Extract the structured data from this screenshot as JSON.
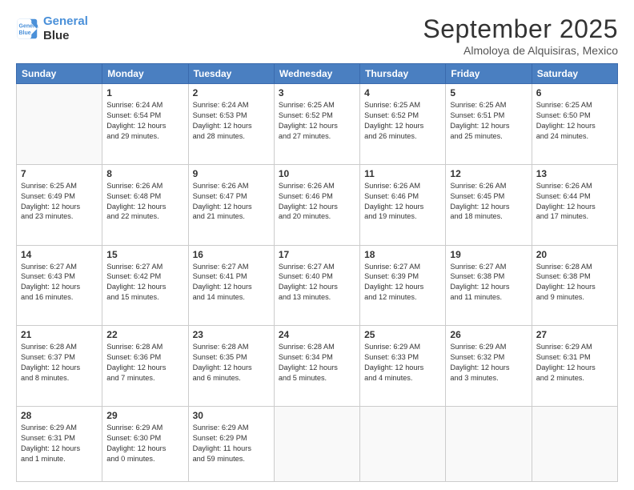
{
  "logo": {
    "line1": "General",
    "line2": "Blue"
  },
  "title": "September 2025",
  "subtitle": "Almoloya de Alquisiras, Mexico",
  "days_header": [
    "Sunday",
    "Monday",
    "Tuesday",
    "Wednesday",
    "Thursday",
    "Friday",
    "Saturday"
  ],
  "weeks": [
    [
      {
        "num": "",
        "info": ""
      },
      {
        "num": "1",
        "info": "Sunrise: 6:24 AM\nSunset: 6:54 PM\nDaylight: 12 hours\nand 29 minutes."
      },
      {
        "num": "2",
        "info": "Sunrise: 6:24 AM\nSunset: 6:53 PM\nDaylight: 12 hours\nand 28 minutes."
      },
      {
        "num": "3",
        "info": "Sunrise: 6:25 AM\nSunset: 6:52 PM\nDaylight: 12 hours\nand 27 minutes."
      },
      {
        "num": "4",
        "info": "Sunrise: 6:25 AM\nSunset: 6:52 PM\nDaylight: 12 hours\nand 26 minutes."
      },
      {
        "num": "5",
        "info": "Sunrise: 6:25 AM\nSunset: 6:51 PM\nDaylight: 12 hours\nand 25 minutes."
      },
      {
        "num": "6",
        "info": "Sunrise: 6:25 AM\nSunset: 6:50 PM\nDaylight: 12 hours\nand 24 minutes."
      }
    ],
    [
      {
        "num": "7",
        "info": "Sunrise: 6:25 AM\nSunset: 6:49 PM\nDaylight: 12 hours\nand 23 minutes."
      },
      {
        "num": "8",
        "info": "Sunrise: 6:26 AM\nSunset: 6:48 PM\nDaylight: 12 hours\nand 22 minutes."
      },
      {
        "num": "9",
        "info": "Sunrise: 6:26 AM\nSunset: 6:47 PM\nDaylight: 12 hours\nand 21 minutes."
      },
      {
        "num": "10",
        "info": "Sunrise: 6:26 AM\nSunset: 6:46 PM\nDaylight: 12 hours\nand 20 minutes."
      },
      {
        "num": "11",
        "info": "Sunrise: 6:26 AM\nSunset: 6:46 PM\nDaylight: 12 hours\nand 19 minutes."
      },
      {
        "num": "12",
        "info": "Sunrise: 6:26 AM\nSunset: 6:45 PM\nDaylight: 12 hours\nand 18 minutes."
      },
      {
        "num": "13",
        "info": "Sunrise: 6:26 AM\nSunset: 6:44 PM\nDaylight: 12 hours\nand 17 minutes."
      }
    ],
    [
      {
        "num": "14",
        "info": "Sunrise: 6:27 AM\nSunset: 6:43 PM\nDaylight: 12 hours\nand 16 minutes."
      },
      {
        "num": "15",
        "info": "Sunrise: 6:27 AM\nSunset: 6:42 PM\nDaylight: 12 hours\nand 15 minutes."
      },
      {
        "num": "16",
        "info": "Sunrise: 6:27 AM\nSunset: 6:41 PM\nDaylight: 12 hours\nand 14 minutes."
      },
      {
        "num": "17",
        "info": "Sunrise: 6:27 AM\nSunset: 6:40 PM\nDaylight: 12 hours\nand 13 minutes."
      },
      {
        "num": "18",
        "info": "Sunrise: 6:27 AM\nSunset: 6:39 PM\nDaylight: 12 hours\nand 12 minutes."
      },
      {
        "num": "19",
        "info": "Sunrise: 6:27 AM\nSunset: 6:38 PM\nDaylight: 12 hours\nand 11 minutes."
      },
      {
        "num": "20",
        "info": "Sunrise: 6:28 AM\nSunset: 6:38 PM\nDaylight: 12 hours\nand 9 minutes."
      }
    ],
    [
      {
        "num": "21",
        "info": "Sunrise: 6:28 AM\nSunset: 6:37 PM\nDaylight: 12 hours\nand 8 minutes."
      },
      {
        "num": "22",
        "info": "Sunrise: 6:28 AM\nSunset: 6:36 PM\nDaylight: 12 hours\nand 7 minutes."
      },
      {
        "num": "23",
        "info": "Sunrise: 6:28 AM\nSunset: 6:35 PM\nDaylight: 12 hours\nand 6 minutes."
      },
      {
        "num": "24",
        "info": "Sunrise: 6:28 AM\nSunset: 6:34 PM\nDaylight: 12 hours\nand 5 minutes."
      },
      {
        "num": "25",
        "info": "Sunrise: 6:29 AM\nSunset: 6:33 PM\nDaylight: 12 hours\nand 4 minutes."
      },
      {
        "num": "26",
        "info": "Sunrise: 6:29 AM\nSunset: 6:32 PM\nDaylight: 12 hours\nand 3 minutes."
      },
      {
        "num": "27",
        "info": "Sunrise: 6:29 AM\nSunset: 6:31 PM\nDaylight: 12 hours\nand 2 minutes."
      }
    ],
    [
      {
        "num": "28",
        "info": "Sunrise: 6:29 AM\nSunset: 6:31 PM\nDaylight: 12 hours\nand 1 minute."
      },
      {
        "num": "29",
        "info": "Sunrise: 6:29 AM\nSunset: 6:30 PM\nDaylight: 12 hours\nand 0 minutes."
      },
      {
        "num": "30",
        "info": "Sunrise: 6:29 AM\nSunset: 6:29 PM\nDaylight: 11 hours\nand 59 minutes."
      },
      {
        "num": "",
        "info": ""
      },
      {
        "num": "",
        "info": ""
      },
      {
        "num": "",
        "info": ""
      },
      {
        "num": "",
        "info": ""
      }
    ]
  ]
}
